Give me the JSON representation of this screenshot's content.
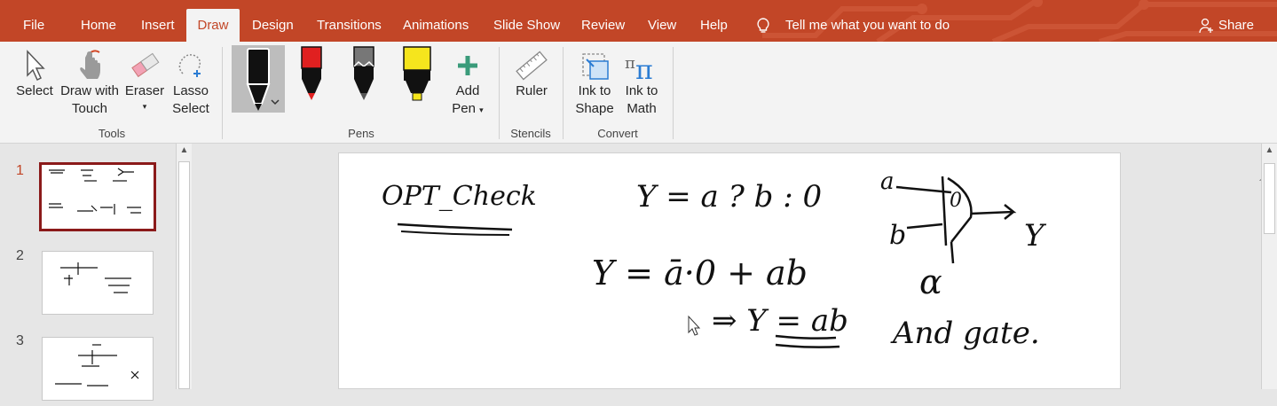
{
  "tabs": [
    {
      "label": "File"
    },
    {
      "label": "Home"
    },
    {
      "label": "Insert"
    },
    {
      "label": "Draw"
    },
    {
      "label": "Design"
    },
    {
      "label": "Transitions"
    },
    {
      "label": "Animations"
    },
    {
      "label": "Slide Show"
    },
    {
      "label": "Review"
    },
    {
      "label": "View"
    },
    {
      "label": "Help"
    }
  ],
  "tell_me": "Tell me what you want to do",
  "share": "Share",
  "ribbon": {
    "tools": {
      "select": "Select",
      "draw_touch_1": "Draw with",
      "draw_touch_2": "Touch",
      "eraser": "Eraser",
      "lasso_1": "Lasso",
      "lasso_2": "Select",
      "group": "Tools"
    },
    "pens": {
      "add_pen_1": "Add",
      "add_pen_2": "Pen",
      "group": "Pens"
    },
    "stencils": {
      "ruler": "Ruler",
      "group": "Stencils"
    },
    "convert": {
      "ink_shape_1": "Ink to",
      "ink_shape_2": "Shape",
      "ink_math_1": "Ink to",
      "ink_math_2": "Math",
      "group": "Convert"
    }
  },
  "thumbnails": [
    {
      "number": "1"
    },
    {
      "number": "2"
    },
    {
      "number": "3"
    }
  ],
  "colors": {
    "accent": "#c24627",
    "selected_thumb_border": "#8b1a1a",
    "red_pen": "#e02020",
    "yellow_highlighter": "#f5e51d"
  },
  "slide_ink": {
    "title": "OPT_Check",
    "eq1": "Y = a ? b : 0",
    "eq2": "Y = ā·0 + ab",
    "eq3": "⇒ Y = ab",
    "gate_a": "a",
    "gate_b": "b",
    "gate_0": "0",
    "gate_y": "Y",
    "alpha": "α",
    "and_gate": "And gate."
  }
}
